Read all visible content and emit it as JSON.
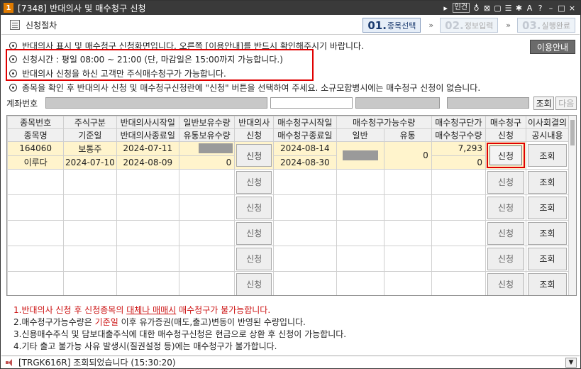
{
  "window": {
    "badge": "1",
    "title": "[7348] 반대의사 및 매수청구 신청",
    "link_label": "인건"
  },
  "header": {
    "section_title": "신청절차",
    "steps": [
      {
        "num": "01.",
        "label": "종목선택"
      },
      {
        "num": "02.",
        "label": "정보입력"
      },
      {
        "num": "03.",
        "label": "실행완료"
      }
    ],
    "step_sep": "»"
  },
  "info": [
    "반대의사 표시 및 매수청구 신청화면입니다. 오른쪽 [이용안내]를 반드시 확인해주시기 바랍니다.",
    "신청시간 : 평일 08:00 ~ 21:00 (단, 마감일은 15:00까지 가능합니다.)",
    "반대의사 신청을 하신 고객만 주식매수청구가 가능합니다.",
    "종목을 확인 후 반대의사 신청 및 매수청구신청란에 \"신청\" 버튼을 선택하여 주세요. 소규모합병시에는 매수청구 신청이 없습니다."
  ],
  "guide_button": "이용안내",
  "account": {
    "label": "계좌번호",
    "query_button": "조회",
    "next_button": "다음"
  },
  "table": {
    "header_top": [
      "종목번호",
      "주식구분",
      "반대의사시작일",
      "일반보유수량",
      "반대의사",
      "매수청구시작일",
      "매수청구가능수량",
      "매수청구단가",
      "매수청구",
      "이사회결의"
    ],
    "header_bottom": [
      "종목명",
      "기준일",
      "반대의사종료일",
      "유통보유수량",
      "신청",
      "매수청구종료일",
      "일반",
      "유통",
      "매수청구수량",
      "신청",
      "공시내용"
    ],
    "rows": [
      {
        "code": "164060",
        "name": "이루다",
        "stock_type": "보통주",
        "base_date": "2024-07-10",
        "opp_start": "2024-07-11",
        "opp_end": "2024-08-09",
        "circ_qty": "0",
        "opp_btn": "신청",
        "buy_start": "2024-08-14",
        "buy_end": "2024-08-30",
        "circ_avail": "0",
        "unit_price": "7,293",
        "buy_qty": "0",
        "buy_btn": "신청",
        "notice_btn": "조회"
      }
    ],
    "empty_apply": "신청",
    "empty_notice": "조회"
  },
  "notes": {
    "n1_pre": "1.반대의사 신청 후 신청종목의 ",
    "n1_link": "대체나 매매시",
    "n1_post": " 매수청구가 불가능합니다.",
    "n2_pre": "2.매수청구가능수량은 ",
    "n2_red": "기준일",
    "n2_post": " 이후 유가증권(매도,출고)변동이 반영된 수량입니다.",
    "n3": "3.신용매수주식 및 담보대출주식에 대한 매수청구신청은 현금으로 상환 후 신청이 가능합니다.",
    "n4": "4.기타 출고 불가능 사유 발생시(질권설정 등)에는 매수청구가 불가합니다."
  },
  "status": {
    "message": "[TRGK616R] 조회되었습니다 (15:30:20)"
  },
  "colors": {
    "highlight": "#e00000",
    "row_bg": "#fff4cc",
    "titlebar": "#3a3a3a"
  }
}
